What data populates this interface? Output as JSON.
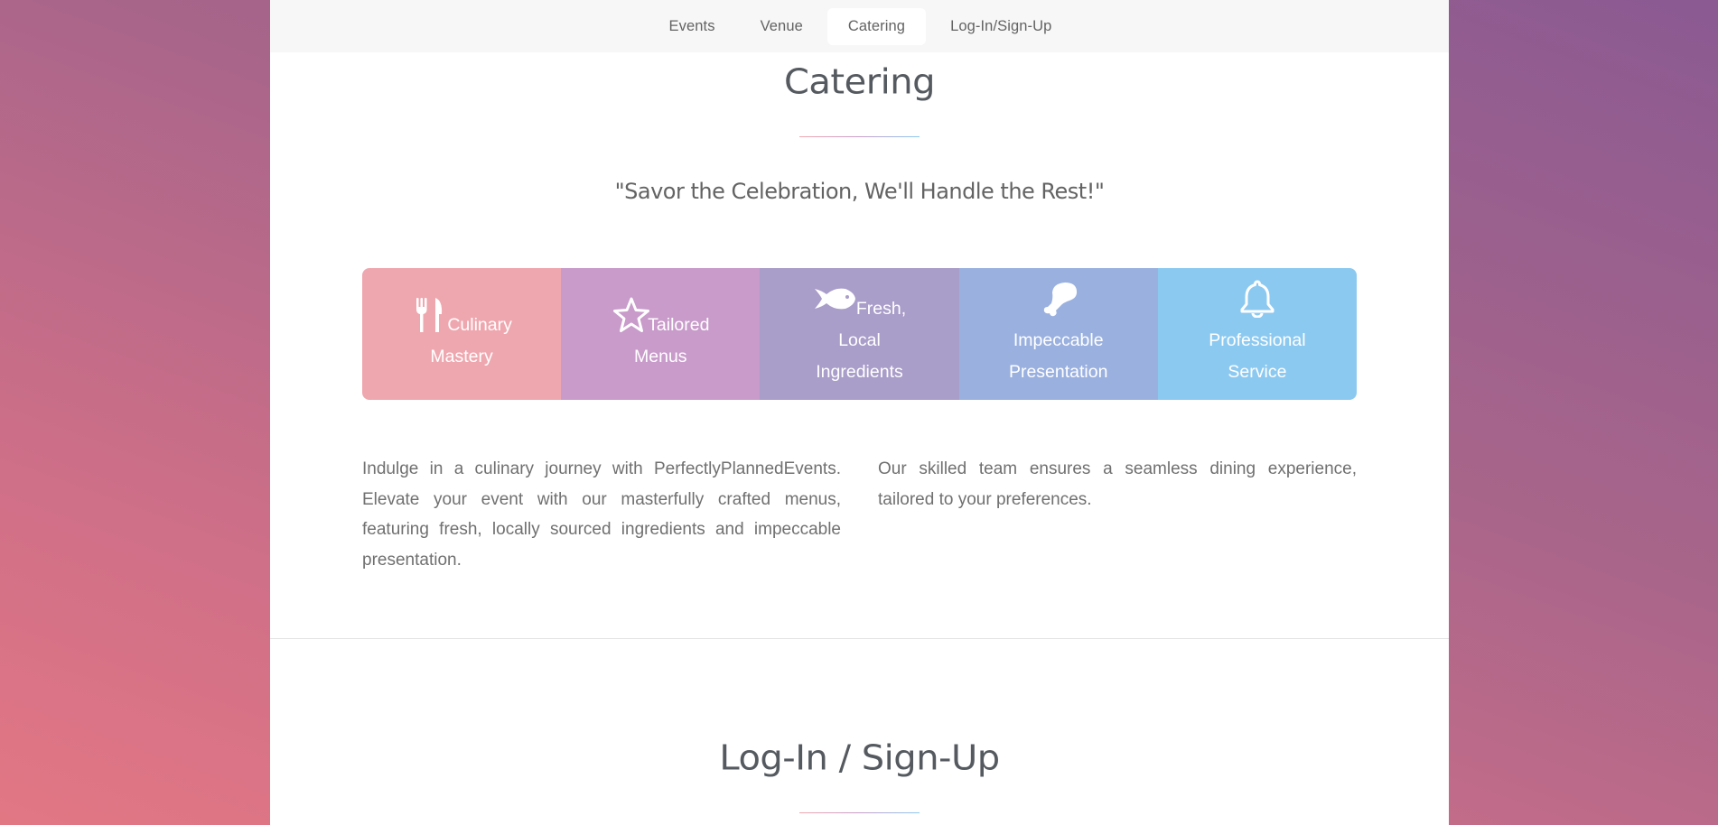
{
  "nav": {
    "items": [
      {
        "label": "Events",
        "active": false
      },
      {
        "label": "Venue",
        "active": false
      },
      {
        "label": "Catering",
        "active": true
      },
      {
        "label": "Log-In/Sign-Up",
        "active": false
      }
    ]
  },
  "catering": {
    "title": "Catering",
    "tagline": "\"Savor the Celebration, We'll Handle the Rest!\"",
    "features": [
      {
        "icon": "cutlery-icon",
        "label": "Culinary Mastery",
        "color": "#efa7af"
      },
      {
        "icon": "star-icon",
        "label": "Tailored Menus",
        "color": "#c89bca"
      },
      {
        "icon": "fish-icon",
        "label": "Fresh, Local Ingredients",
        "color": "#a99dc9"
      },
      {
        "icon": "drumstick-icon",
        "label": "Impeccable Presentation",
        "color": "#9ab0df"
      },
      {
        "icon": "bell-icon",
        "label": "Professional Service",
        "color": "#8cc9f0"
      }
    ],
    "paragraph_left": "Indulge in a culinary journey with PerfectlyPlannedEvents. Elevate your event with our masterfully crafted menus, featuring fresh, locally sourced ingredients and impeccable presentation.",
    "paragraph_right": "Our skilled team ensures a seamless dining experience, tailored to your preferences."
  },
  "login": {
    "title": "Log-In / Sign-Up"
  }
}
